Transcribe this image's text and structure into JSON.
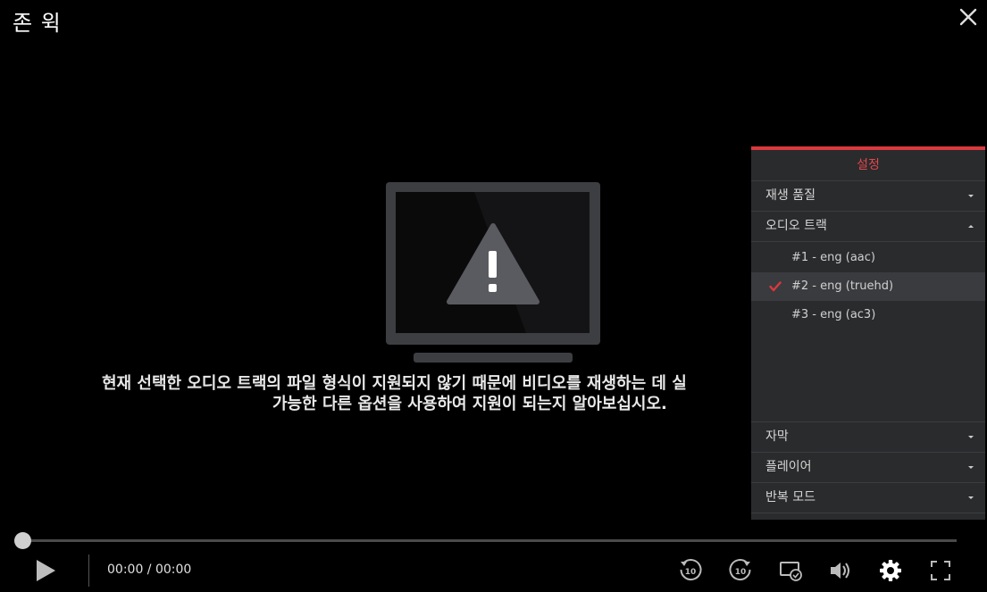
{
  "window": {
    "title": "존 윅"
  },
  "error": {
    "line1": "현재 선택한 오디오 트랙의 파일 형식이 지원되지 않기 때문에 비디오를 재생하는 데 실",
    "line2": "가능한 다른 옵션을 사용하여 지원이 되는지 알아보십시오."
  },
  "settings": {
    "title": "설정",
    "quality_label": "재생 품질",
    "audio_track_label": "오디오 트랙",
    "tracks": [
      {
        "label": "#1 - eng (aac)",
        "selected": false
      },
      {
        "label": "#2 - eng (truehd)",
        "selected": true
      },
      {
        "label": "#3 - eng (ac3)",
        "selected": false
      }
    ],
    "subtitle_label": "자막",
    "player_label": "플레이어",
    "repeat_label": "반복 모드"
  },
  "controls": {
    "time": "00:00 / 00:00",
    "progress": 0,
    "rewind_seconds": "10",
    "forward_seconds": "10"
  },
  "colors": {
    "accent": "#d9393f",
    "panel_bg": "#2a2b2d"
  }
}
